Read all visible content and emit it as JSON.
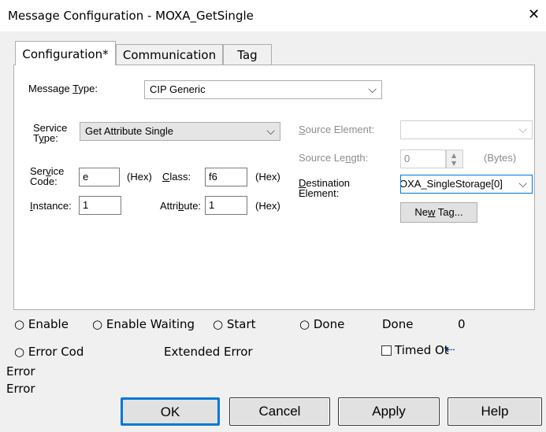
{
  "window": {
    "title": "Message Configuration - MOXA_GetSingle",
    "close_glyph": "✕"
  },
  "tabs": [
    {
      "label": "Configuration*"
    },
    {
      "label": "Communication"
    },
    {
      "label": "Tag"
    }
  ],
  "config": {
    "message_type_label": "Message Type:",
    "message_type_value": "CIP Generic",
    "service_type_label_1": "Service",
    "service_type_label_2": "Type:",
    "service_type_value": "Get Attribute Single",
    "service_code_label_1": "Service",
    "service_code_label_2": "Code:",
    "service_code_value": "e",
    "hex_label": "(Hex)",
    "class_label": "Class:",
    "class_value": "f6",
    "instance_label": "Instance:",
    "instance_value": "1",
    "attribute_label": "Attribute:",
    "attribute_value": "1",
    "source_element_label": "Source Element:",
    "source_element_value": "",
    "source_length_label": "Source Length:",
    "source_length_value": "0",
    "bytes_label": "(Bytes)",
    "destination_label_1": "Destination",
    "destination_label_2": "Element:",
    "destination_value": "OXA_SingleStorage[0]",
    "new_tag_label": "New Tag..."
  },
  "status": {
    "enable": "Enable",
    "enable_waiting": "Enable Waiting",
    "start": "Start",
    "done": "Done",
    "done_length_label": "Done",
    "done_length_value": "0",
    "error_code": "Error Cod",
    "extended_error": "Extended Error",
    "timed_out": "Timed Ot",
    "error_line1": "Error",
    "error_line2": "Error"
  },
  "buttons": {
    "ok": "OK",
    "cancel": "Cancel",
    "apply": "Apply",
    "help": "Help"
  }
}
